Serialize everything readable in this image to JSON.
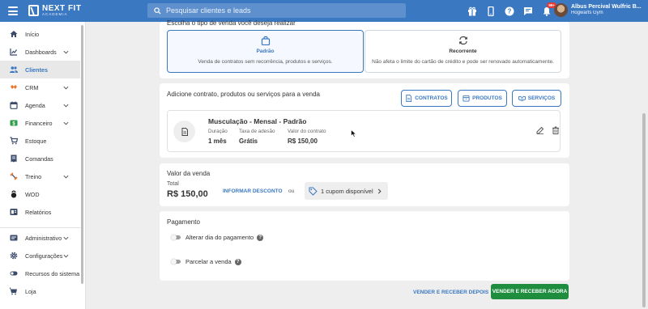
{
  "topbar": {
    "logo_name": "NEXT FIT",
    "logo_sub": "ACADEMIA",
    "search_placeholder": "Pesquisar clientes e leads",
    "notification_badge": "99+",
    "user_name": "Albus Percival Wulfric B...",
    "user_company": "Hogwarts Gym",
    "icons": [
      "gift-icon",
      "mobile-icon",
      "help-icon",
      "chat-icon",
      "bell-icon"
    ]
  },
  "sidebar": {
    "items": [
      {
        "label": "Início",
        "icon": "home-icon",
        "active": false,
        "chevron": false
      },
      {
        "label": "Dashboards",
        "icon": "chart-icon",
        "active": false,
        "chevron": true
      },
      {
        "label": "Clientes",
        "icon": "users-icon",
        "active": true,
        "chevron": false
      },
      {
        "label": "CRM",
        "icon": "crm-icon",
        "active": false,
        "chevron": true
      },
      {
        "label": "Agenda",
        "icon": "calendar-icon",
        "active": false,
        "chevron": true
      },
      {
        "label": "Financeiro",
        "icon": "money-icon",
        "active": false,
        "chevron": true
      },
      {
        "label": "Estoque",
        "icon": "cart-icon",
        "active": false,
        "chevron": false
      },
      {
        "label": "Comandas",
        "icon": "receipt-icon",
        "active": false,
        "chevron": false
      },
      {
        "label": "Treino",
        "icon": "dumbbell-icon",
        "active": false,
        "chevron": true
      },
      {
        "label": "WOD",
        "icon": "kettlebell-icon",
        "active": false,
        "chevron": false
      },
      {
        "label": "Relatórios",
        "icon": "report-icon",
        "active": false,
        "chevron": false
      },
      {
        "label": "Administrativo",
        "icon": "admin-icon",
        "active": false,
        "chevron": true
      },
      {
        "label": "Configurações",
        "icon": "gear-icon",
        "active": false,
        "chevron": true
      },
      {
        "label": "Recursos do sistema",
        "icon": "toggle-icon",
        "active": false,
        "chevron": false
      },
      {
        "label": "Loja",
        "icon": "store-icon",
        "active": false,
        "chevron": false
      }
    ]
  },
  "sale_type": {
    "title": "Escolha o tipo de venda você deseja realizar",
    "padrao": {
      "title": "Padrão",
      "desc": "Venda de contratos sem recorrência, produtos e serviços."
    },
    "recorrente": {
      "title": "Recorrente",
      "desc": "Não afeta o limite do cartão de crédito e pode ser renovado automaticamente."
    }
  },
  "items_section": {
    "title": "Adicione contrato, produtos ou serviços para a venda",
    "btn_contratos": "CONTRATOS",
    "btn_produtos": "PRODUTOS",
    "btn_servicos": "SERVIÇOS",
    "item": {
      "name": "Musculação - Mensal - Padrão",
      "duracao_label": "Duração",
      "duracao_value": "1 mês",
      "taxa_label": "Taxa de adesão",
      "taxa_value": "Grátis",
      "valor_label": "Valor do contrato",
      "valor_value": "R$ 150,00"
    }
  },
  "sale_value": {
    "title": "Valor da venda",
    "total_label": "Total",
    "total_value": "R$ 150,00",
    "discount_link": "INFORMAR DESCONTO",
    "or_text": "ou",
    "coupon_text": "1 cupom disponível"
  },
  "payment": {
    "title": "Pagamento",
    "toggle_day": "Alterar dia do pagamento",
    "toggle_installments": "Parcelar a venda"
  },
  "actions": {
    "sell_later": "VENDER E RECEBER DEPOIS",
    "sell_now": "VENDER E RECEBER AGORA"
  },
  "colors": {
    "primary": "#3b78c2",
    "success": "#1e8e3e",
    "background": "#eeeeee"
  }
}
